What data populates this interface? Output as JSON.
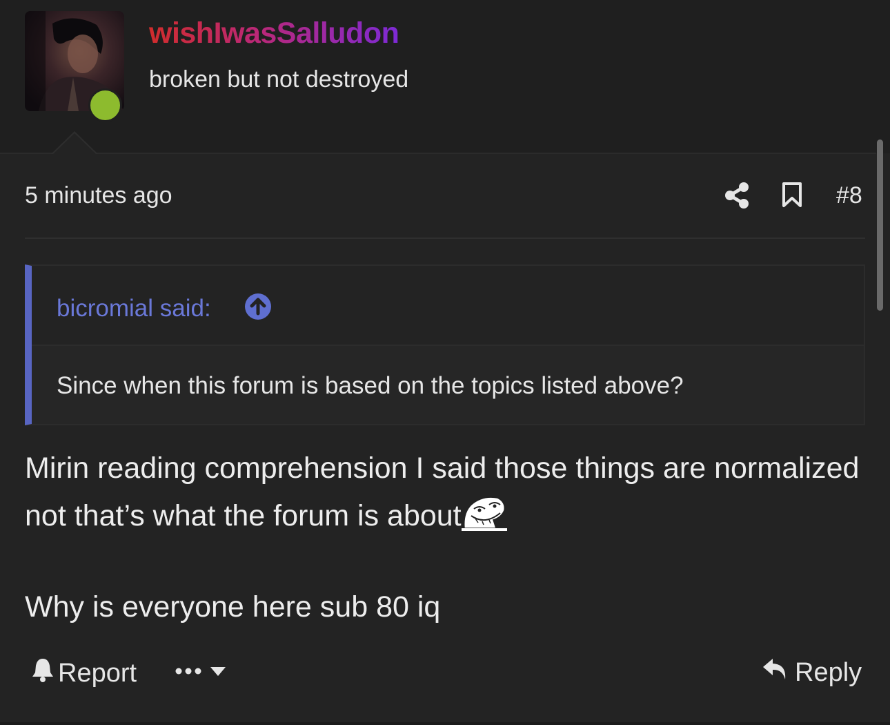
{
  "user": {
    "name": "wishIwasSalludon",
    "title": "broken but not destroyed",
    "online": true
  },
  "post": {
    "time": "5 minutes ago",
    "number": "#8",
    "quote": {
      "author": "bicromial said:",
      "text": "Since when this forum is based on the topics listed above?"
    },
    "body": {
      "line1": "Mirin reading comprehension I said those things are normalized not that’s what the forum is about",
      "line2": "Why is everyone here sub 80 iq"
    }
  },
  "actions": {
    "report_label": "Report",
    "reply_label": "Reply"
  },
  "icons": {
    "share": "share-icon",
    "bookmark": "bookmark-icon",
    "quote_jump": "arrow-up-circle-icon",
    "report": "bell-icon",
    "more": "ellipsis-icon",
    "dropdown": "caret-down-icon",
    "reply": "reply-arrow-icon",
    "emoji": "troll-face-emoji"
  },
  "colors": {
    "background": "#232323",
    "header_background": "#1f1f1f",
    "quote_accent": "#5865c2",
    "quote_author": "#6a78d8",
    "online": "#8dbb2e",
    "username_gradient": [
      "#d12c2c",
      "#b9287a",
      "#7d2ad6"
    ]
  }
}
